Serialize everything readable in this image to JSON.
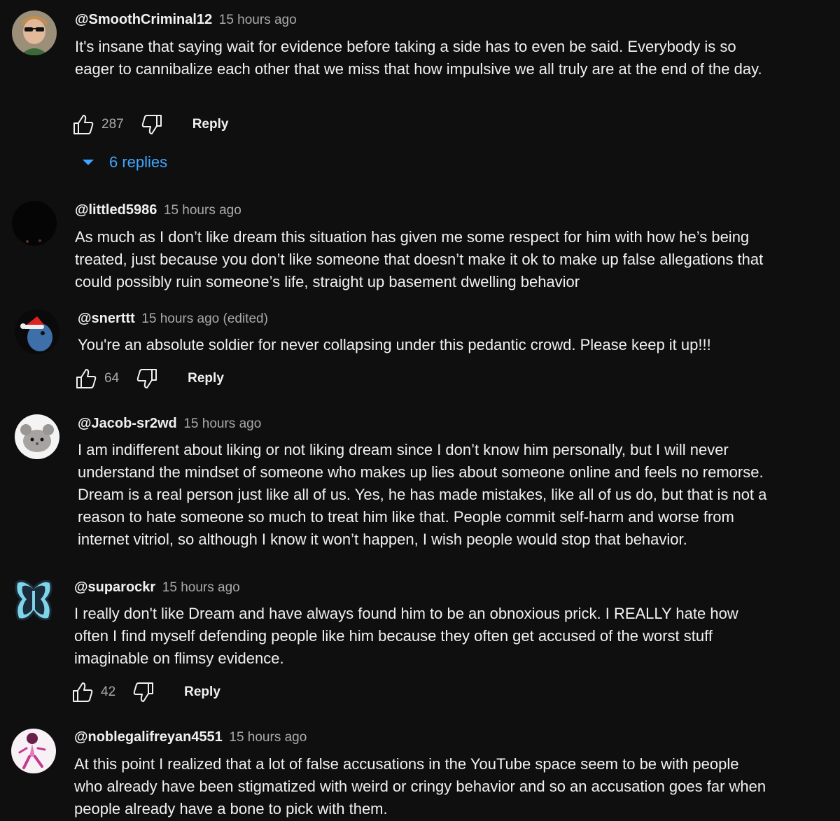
{
  "comments": [
    {
      "author": "@SmoothCriminal12",
      "time": "15 hours ago",
      "text": "It's insane that saying wait for evidence before taking a side has to even be said. Everybody is so eager to cannibalize each other that we miss that how impulsive we all truly are at the end of the day.",
      "likes": "287",
      "reply_label": "Reply",
      "replies_label": "6 replies",
      "avatar": "avatar-sunglasses-man"
    },
    {
      "author": "@littled5986",
      "time": "15 hours ago",
      "text": "As much as I don’t like dream this situation has given me some respect for him with how he’s being treated, just because you don’t like someone that doesn’t make it ok to make up false allegations that could possibly ruin someone’s life, straight up basement dwelling behavior",
      "avatar": "avatar-dark"
    },
    {
      "author": "@snerttt",
      "time": "15 hours ago (edited)",
      "text": "You're an absolute soldier for never collapsing under this pedantic crowd. Please keep it up!!!",
      "likes": "64",
      "reply_label": "Reply",
      "avatar": "avatar-blue-bird-santa-hat"
    },
    {
      "author": "@Jacob-sr2wd",
      "time": "15 hours ago",
      "text": "I am indifferent about liking or not liking dream since I don’t know him personally, but I will never understand the mindset of someone who makes up lies about someone online and feels no remorse. Dream is a real person just like all of us. Yes, he has made mistakes, like all of us do, but that is not a reason to hate someone so much to treat him like that. People commit self-harm and worse from internet vitriol, so although I know it won’t happen, I wish people would stop that behavior.",
      "avatar": "avatar-chinchilla"
    },
    {
      "author": "@suparockr",
      "time": "15 hours ago",
      "text": "I really don't like Dream and have always found him to be an obnoxious prick.  I REALLY hate how often I find myself defending people like him because they often get accused of the worst stuff imaginable on flimsy evidence.",
      "likes": "42",
      "reply_label": "Reply",
      "avatar": "avatar-butterfly"
    },
    {
      "author": "@noblegalifreyan4551",
      "time": "15 hours ago",
      "text": "At this point I realized that a lot of false accusations in the YouTube space seem to be with people who already have been stigmatized with weird or cringy behavior and so an accusation goes far when people already have a bone to pick with them.",
      "avatar": "avatar-pink-character"
    }
  ]
}
